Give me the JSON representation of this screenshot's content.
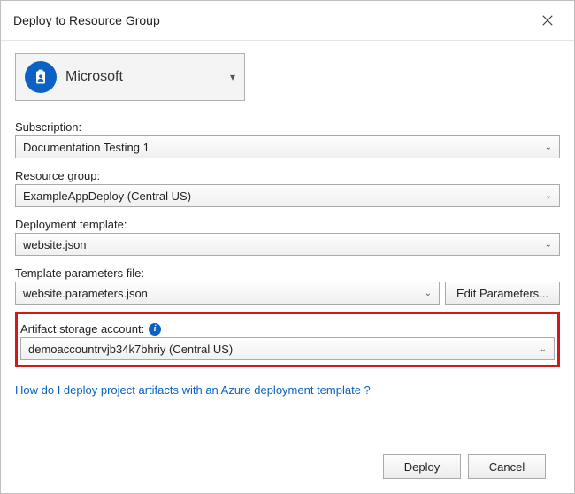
{
  "dialog": {
    "title": "Deploy to Resource Group"
  },
  "account": {
    "name": "Microsoft"
  },
  "fields": {
    "subscription": {
      "label": "Subscription:",
      "value": "Documentation Testing 1"
    },
    "resourceGroup": {
      "label": "Resource group:",
      "value": "ExampleAppDeploy (Central US)"
    },
    "deploymentTemplate": {
      "label": "Deployment template:",
      "value": "website.json"
    },
    "templateParameters": {
      "label": "Template parameters file:",
      "value": "website.parameters.json",
      "editButton": "Edit Parameters..."
    },
    "artifactStorage": {
      "label": "Artifact storage account:",
      "value": "demoaccountrvjb34k7bhriy (Central US)"
    }
  },
  "helpLink": "How do I deploy project artifacts with an Azure deployment template ?",
  "buttons": {
    "deploy": "Deploy",
    "cancel": "Cancel"
  },
  "info_glyph": "i"
}
